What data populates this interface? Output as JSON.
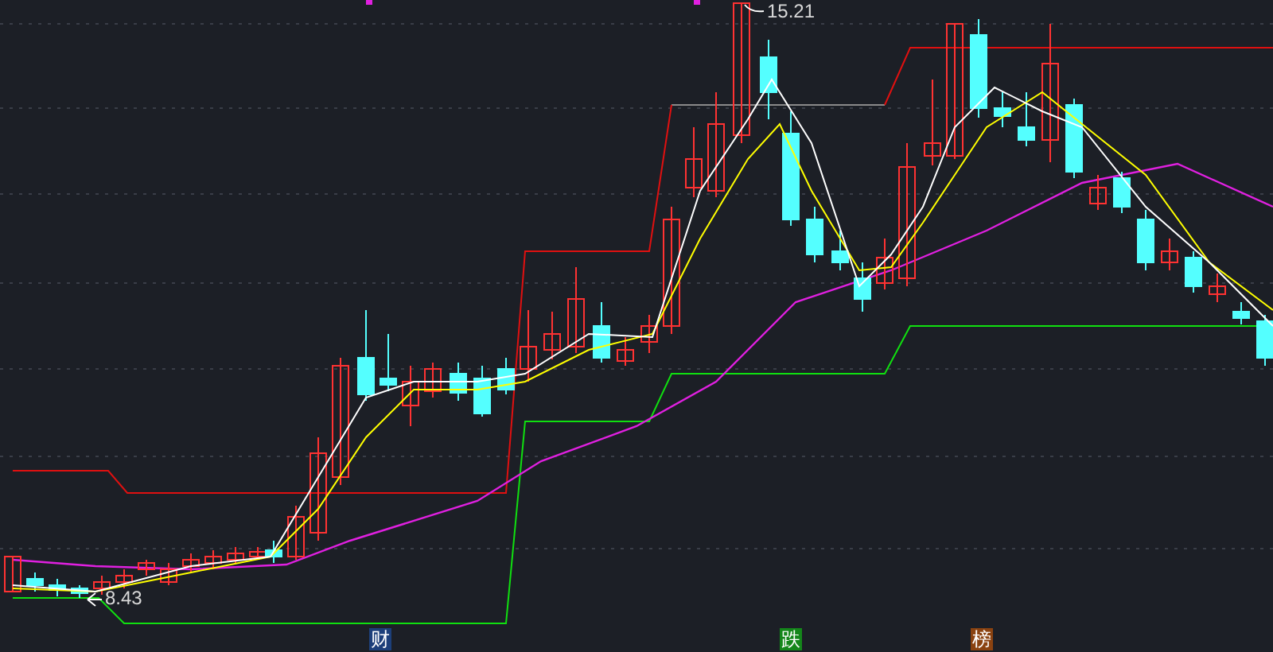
{
  "chart": {
    "high_label": "15.21",
    "low_label": "8.43"
  },
  "event_markers": [
    {
      "label": "财",
      "color": "#1d3f7a"
    },
    {
      "label": "跌",
      "color": "#14861a"
    },
    {
      "label": "榜",
      "color": "#8a4210"
    }
  ]
}
